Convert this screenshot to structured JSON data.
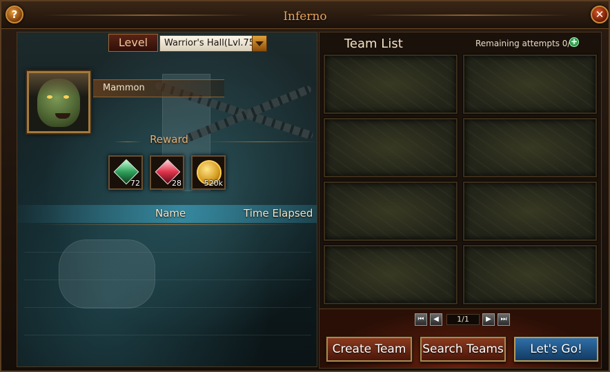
{
  "window": {
    "title": "Inferno",
    "help_label": "?",
    "close_label": "✕"
  },
  "level": {
    "tab_label": "Level",
    "selected": "Warrior's Hall(Lvl.75"
  },
  "boss": {
    "name": "Mammon"
  },
  "reward": {
    "title": "Reward",
    "items": [
      {
        "icon": "green-gem-icon",
        "count": "72"
      },
      {
        "icon": "red-gem-icon",
        "count": "28"
      },
      {
        "icon": "gold-coin-icon",
        "count": "520k"
      }
    ]
  },
  "records": {
    "col_name": "Name",
    "col_time": "Time Elapsed"
  },
  "team_list": {
    "title": "Team List",
    "remaining": "Remaining attempts 0/2",
    "add_label": "+"
  },
  "pager": {
    "first": "⏮",
    "prev": "◀",
    "page": "1/1",
    "next": "▶",
    "last": "⏭"
  },
  "actions": {
    "create": "Create Team",
    "search": "Search Teams",
    "go": "Let's Go!"
  }
}
